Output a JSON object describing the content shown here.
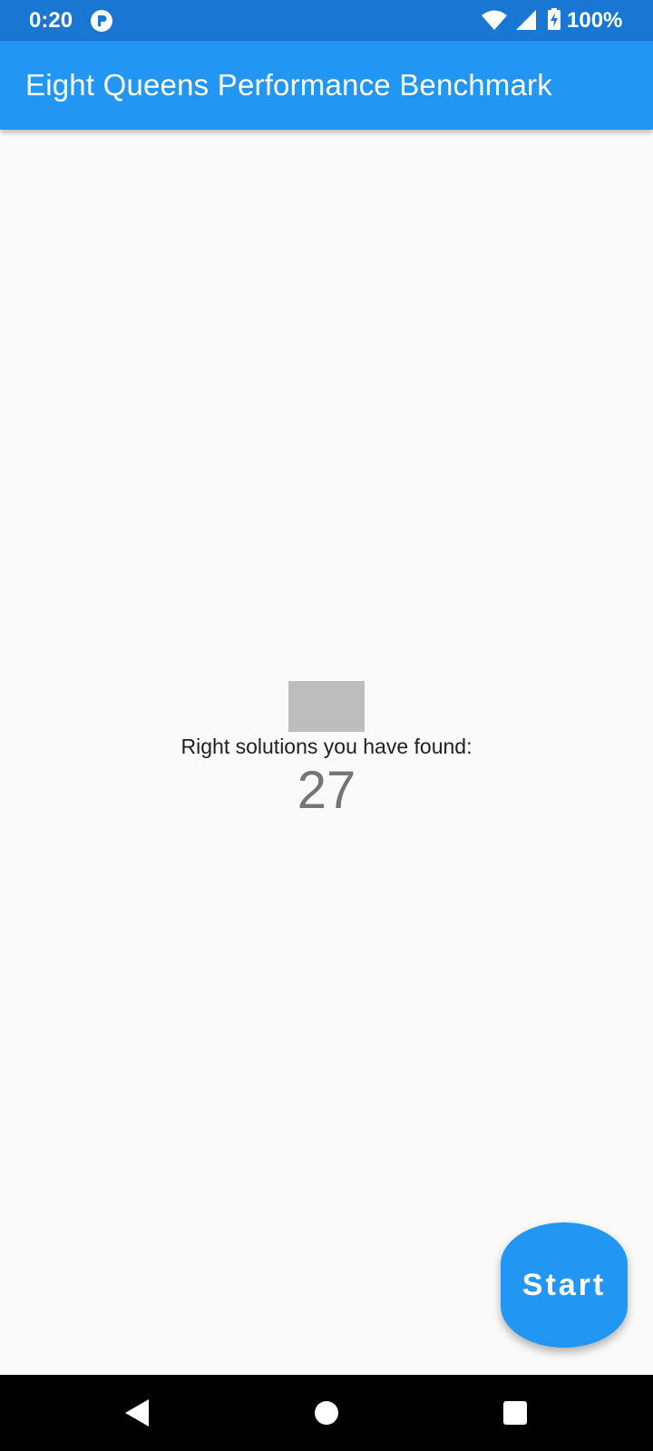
{
  "status_bar": {
    "time": "0:20",
    "battery": "100%",
    "icons": [
      "app-notification-icon",
      "wifi-icon",
      "signal-icon",
      "battery-charging-icon"
    ]
  },
  "app_bar": {
    "title": "Eight Queens Performance Benchmark",
    "color": "#2196f3"
  },
  "main": {
    "label": "Right solutions you have found:",
    "count": "27"
  },
  "fab": {
    "label": "Start",
    "color": "#2196f3"
  },
  "nav_bar": {
    "icons": [
      "back-icon",
      "home-icon",
      "recents-icon"
    ]
  }
}
